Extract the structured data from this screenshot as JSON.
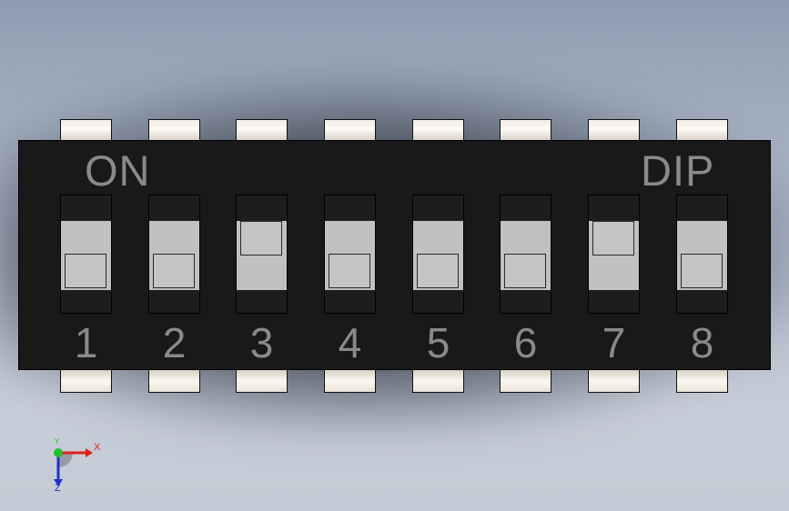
{
  "component": {
    "top_left_label": "ON",
    "top_right_label": "DIP",
    "switches": [
      {
        "number": "1",
        "state": "off"
      },
      {
        "number": "2",
        "state": "off"
      },
      {
        "number": "3",
        "state": "on"
      },
      {
        "number": "4",
        "state": "off"
      },
      {
        "number": "5",
        "state": "off"
      },
      {
        "number": "6",
        "state": "off"
      },
      {
        "number": "7",
        "state": "on"
      },
      {
        "number": "8",
        "state": "off"
      }
    ]
  },
  "triad": {
    "x_label": "X",
    "y_label": "Y",
    "z_label": "Z",
    "x_color": "#e0201a",
    "y_color": "#22c030",
    "z_color": "#2030c8"
  },
  "colors": {
    "body": "#191919",
    "label_text": "#8a8a8a",
    "switch_track": "#c1c1c1"
  }
}
